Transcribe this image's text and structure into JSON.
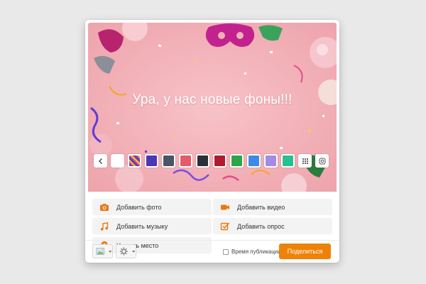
{
  "banner": {
    "text": "Ура, у нас новые фоны!!!",
    "swatches": [
      {
        "name": "swatch-white",
        "color": "#ffffff"
      },
      {
        "name": "swatch-pattern",
        "color": "#6b3fa0"
      },
      {
        "name": "swatch-violet",
        "color": "#4b36b5"
      },
      {
        "name": "swatch-slate",
        "color": "#4c5568"
      },
      {
        "name": "swatch-coral",
        "color": "#e85a66"
      },
      {
        "name": "swatch-dark",
        "color": "#2a2f38"
      },
      {
        "name": "swatch-crimson",
        "color": "#b11b2e"
      },
      {
        "name": "swatch-green",
        "color": "#2fa54a"
      },
      {
        "name": "swatch-blue",
        "color": "#3c8ce6"
      },
      {
        "name": "swatch-lavender",
        "color": "#a58be6"
      },
      {
        "name": "swatch-mint",
        "color": "#27c08f"
      }
    ]
  },
  "actions": {
    "add_photo": "Добавить фото",
    "add_video": "Добавить видео",
    "add_music": "Добавить музыку",
    "add_poll": "Добавить опрос",
    "add_place": "Указать место"
  },
  "bottom": {
    "publication_time": "Время публикации",
    "share": "Поделиться"
  },
  "colors": {
    "accent": "#ee8208",
    "icon_orange": "#e8790f"
  },
  "icons": [
    "chevron-left-icon",
    "grid-icon",
    "instagram-icon",
    "camera-icon",
    "video-icon",
    "music-icon",
    "poll-icon",
    "location-icon",
    "image-icon",
    "gear-icon",
    "caret-down-icon"
  ]
}
